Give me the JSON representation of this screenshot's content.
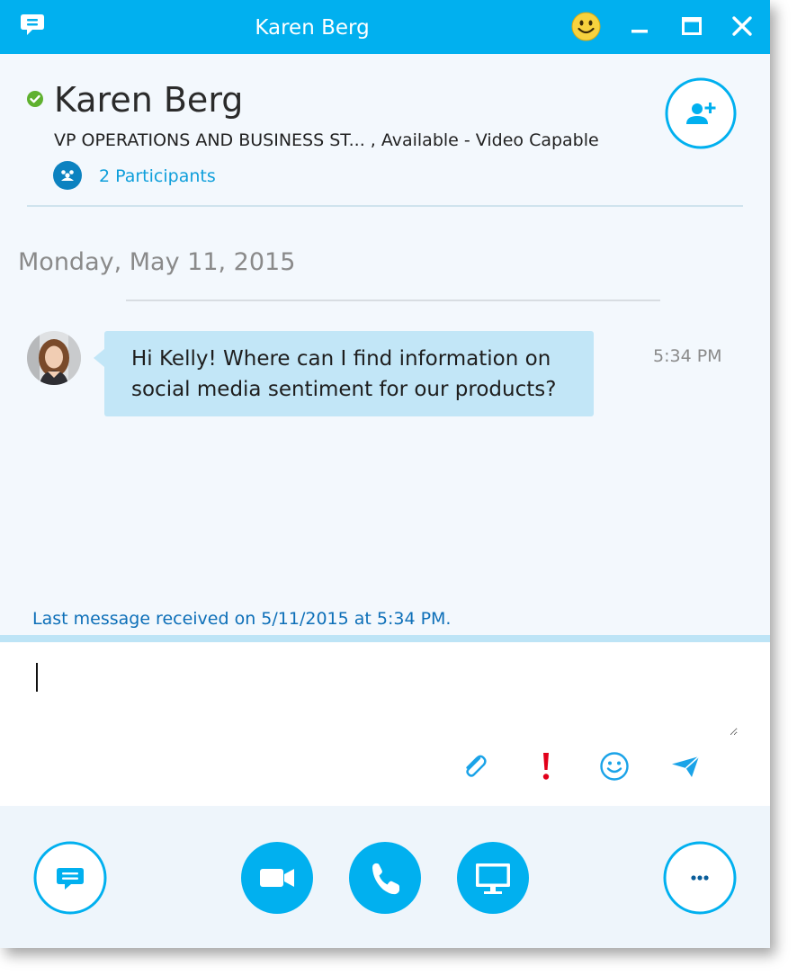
{
  "window": {
    "title": "Karen Berg"
  },
  "header": {
    "contact_name": "Karen Berg",
    "contact_details": "VP OPERATIONS AND BUSINESS ST... ,  Available - Video Capable",
    "participants_label": "2 Participants"
  },
  "conversation": {
    "date": "Monday, May 11, 2015",
    "messages": [
      {
        "text": "Hi Kelly! Where can I find information on social media sentiment for our products?",
        "time": "5:34 PM"
      }
    ],
    "last_message_status": "Last message received on 5/11/2015 at 5:34 PM."
  },
  "compose": {
    "value": "",
    "priority_glyph": "!"
  },
  "toolbar": {
    "more_glyph": "···"
  },
  "colors": {
    "accent": "#01b0ef",
    "presence_available": "#5fb12f",
    "bubble": "#c2e6f7",
    "link": "#0f9fdb",
    "priority": "#e2001a"
  },
  "icons": {
    "app": "skype-chat-icon",
    "title_emoji": "smiley-icon",
    "minimize": "minimize-icon",
    "maximize": "maximize-icon",
    "close": "close-icon",
    "presence": "presence-available-icon",
    "add_participant": "add-person-icon",
    "participants": "people-icon",
    "attach": "paperclip-icon",
    "priority": "exclamation-icon",
    "emoticons": "smiley-outline-icon",
    "send": "send-icon",
    "im": "chat-bubble-icon",
    "video": "video-camera-icon",
    "call": "phone-icon",
    "present": "monitor-icon",
    "more": "ellipsis-icon"
  }
}
